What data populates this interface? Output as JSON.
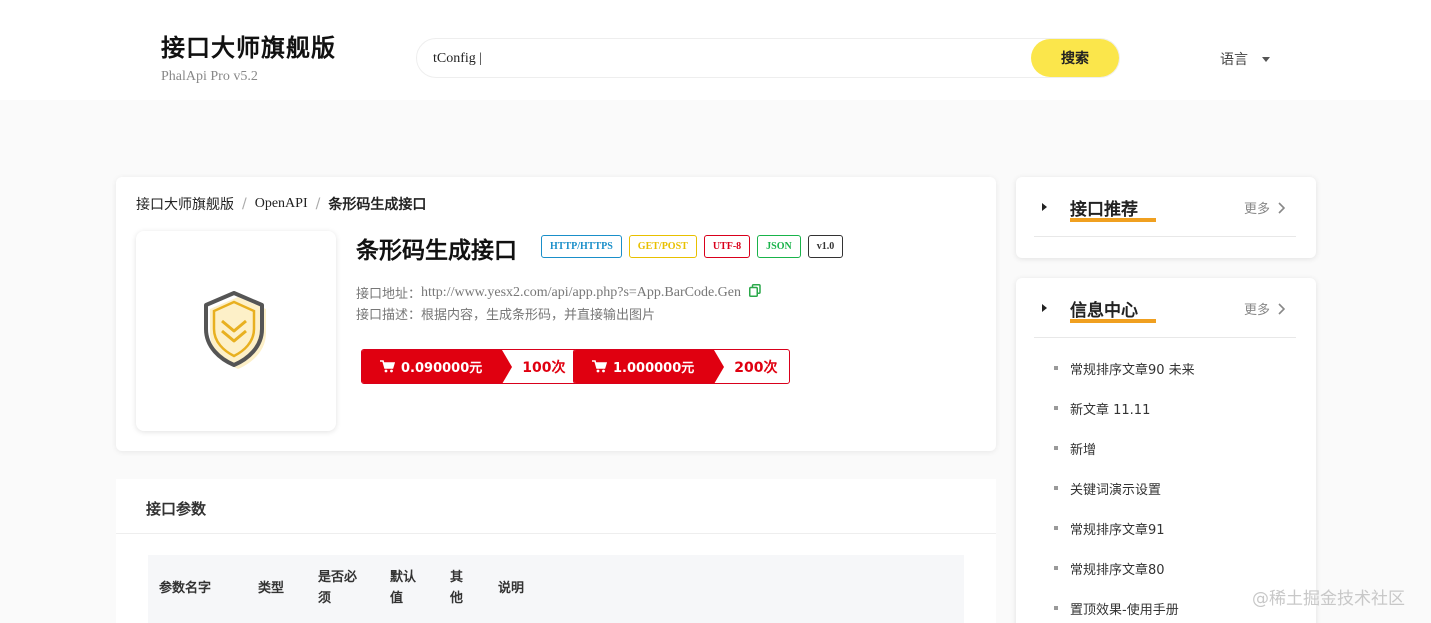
{
  "brand": {
    "title": "接口大师旗舰版",
    "subtitle": "PhalApi Pro v5.2"
  },
  "search": {
    "value": "tConfig |",
    "button_label": "搜索"
  },
  "language": {
    "label": "语言"
  },
  "breadcrumb": {
    "items": [
      "接口大师旗舰版",
      "OpenAPI",
      "条形码生成接口"
    ]
  },
  "api": {
    "title": "条形码生成接口",
    "tags": [
      {
        "label": "HTTP/HTTPS",
        "color": "#1a8fc9"
      },
      {
        "label": "GET/POST",
        "color": "#e8c000"
      },
      {
        "label": "UTF-8",
        "color": "#d9001b"
      },
      {
        "label": "JSON",
        "color": "#19b34a"
      },
      {
        "label": "v1.0",
        "color": "#333333"
      }
    ],
    "address_label": "接口地址：",
    "address_url": "http://www.yesx2.com/api/app.php?s=App.BarCode.Gen",
    "desc_label": "接口描述：",
    "desc_text": "根据内容，生成条形码，并直接输出图片",
    "prices": [
      {
        "price": "0.090000元",
        "count": "100次"
      },
      {
        "price": "1.000000元",
        "count": "200次"
      }
    ]
  },
  "params": {
    "title": "接口参数",
    "headers": [
      "参数名字",
      "类型",
      "是否必\n须",
      "默认\n值",
      "其\n他",
      "说明"
    ]
  },
  "sidebar": {
    "recommend": {
      "title": "接口推荐",
      "more": "更多"
    },
    "info_center": {
      "title": "信息中心",
      "more": "更多",
      "items": [
        "常规排序文章90 未来",
        "新文章 11.11",
        "新增",
        "关键词演示设置",
        "常规排序文章91",
        "常规排序文章80",
        "置顶效果-使用手册"
      ]
    }
  },
  "watermark": "@稀土掘金技术社区",
  "colors": {
    "accent_yellow": "#fbe64b",
    "price_red": "#e00010",
    "underline_orange": "#f0a020"
  }
}
